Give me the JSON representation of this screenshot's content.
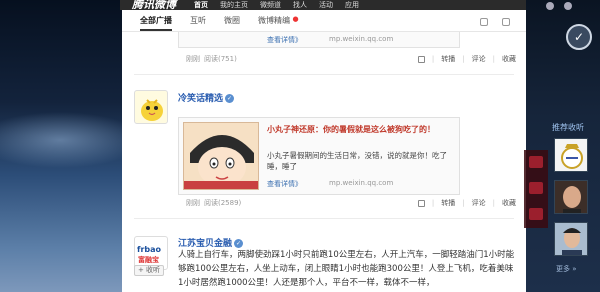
{
  "topbar": {
    "logo": "腾讯微博",
    "nav": [
      "首页",
      "我的主页",
      "微频道",
      "找人",
      "活动",
      "应用"
    ]
  },
  "tabs": {
    "items": [
      "全部广播",
      "互听",
      "微圈",
      "微博精编"
    ]
  },
  "post1": {
    "card_more": "查看详情》",
    "card_url": "mp.weixin.qq.com",
    "time": "刚刚",
    "reads": "阅读(751)"
  },
  "post2": {
    "author": "冷笑话精选",
    "card_title": "小丸子神还原：你的暑假就是这么被狗吃了的！",
    "card_desc": "小丸子暑假期间的生活日常，没错，说的就是你！吃了睡，睡了",
    "card_more": "查看详情》",
    "card_url": "mp.weixin.qq.com",
    "time": "刚刚",
    "reads": "阅读(2589)"
  },
  "post3": {
    "author": "江苏宝贝金融",
    "avatar_text": "frbao",
    "avatar_subtext": "富融宝",
    "follow": "+ 收听",
    "text": "人骑上自行车，两脚使劲踩1小时只前跑10公里左右，人开上汽车，一脚轻踏油门1小时能够跑100公里左右，人坐上动车，闭上眼睛1小时也能跑300公里！人登上飞机，吃着美味1小时居然跑1000公里！人还是那个人，平台不一样，载体不一样，"
  },
  "actions": {
    "repost": "转播",
    "comment": "评论",
    "favorite": "收藏"
  },
  "sidebar": {
    "title": "推荐收听",
    "more": "更多 »"
  },
  "colors": {
    "link": "#3a6fb0",
    "author": "#2a5db0",
    "card_title": "#c0392b",
    "topbar": "#2b2b2b"
  }
}
